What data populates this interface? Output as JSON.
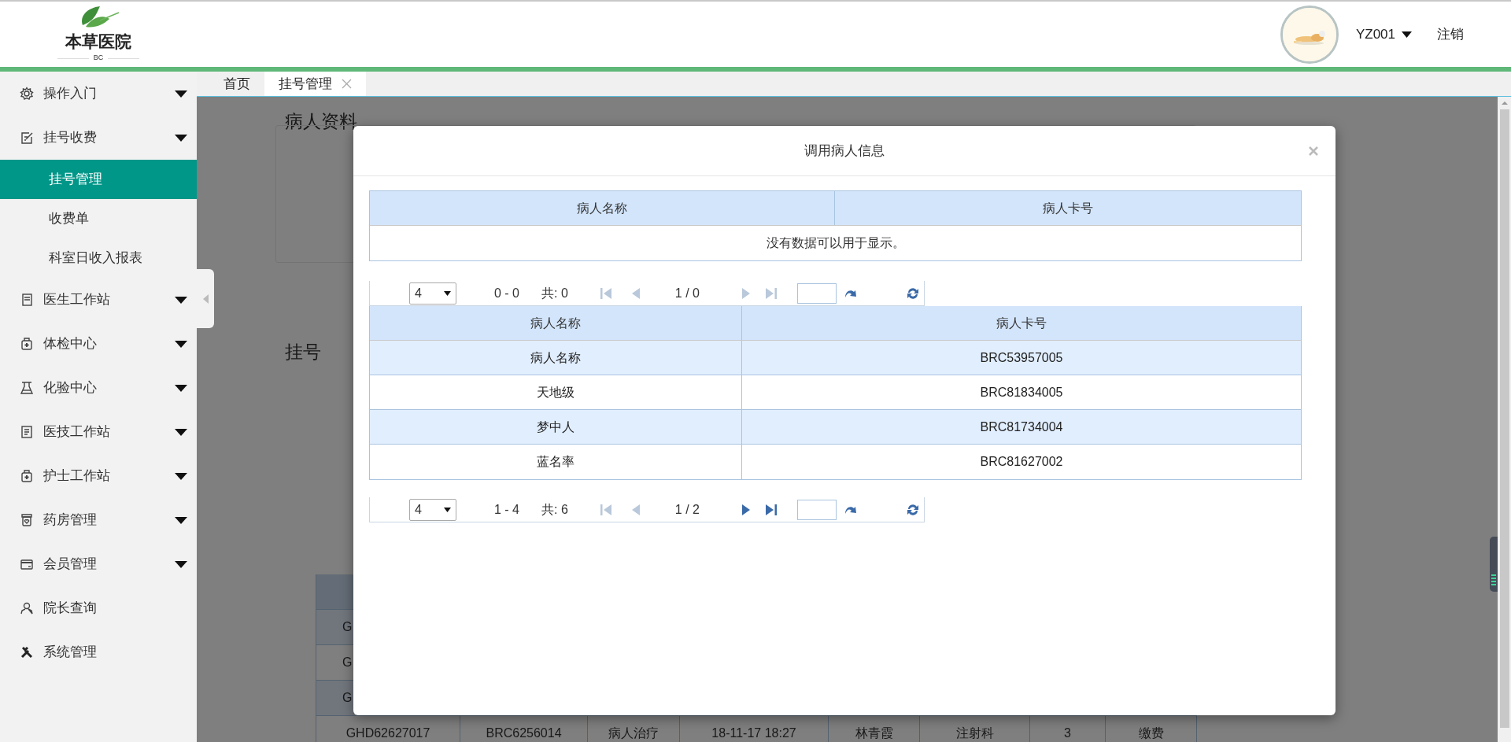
{
  "header": {
    "logo_text": "本草医院",
    "logo_sub": "BC",
    "user": "YZ001",
    "logout": "注销"
  },
  "sidebar": {
    "items": [
      {
        "label": "操作入门",
        "has_submenu": true,
        "selected": false
      },
      {
        "label": "挂号收费",
        "has_submenu": true,
        "selected": false,
        "children": [
          {
            "label": "挂号管理",
            "selected": true
          },
          {
            "label": "收费单",
            "selected": false
          },
          {
            "label": "科室日收入报表",
            "selected": false
          }
        ]
      },
      {
        "label": "医生工作站",
        "has_submenu": true,
        "selected": false
      },
      {
        "label": "体检中心",
        "has_submenu": true,
        "selected": false
      },
      {
        "label": "化验中心",
        "has_submenu": true,
        "selected": false
      },
      {
        "label": "医技工作站",
        "has_submenu": true,
        "selected": false
      },
      {
        "label": "护士工作站",
        "has_submenu": true,
        "selected": false
      },
      {
        "label": "药房管理",
        "has_submenu": true,
        "selected": false
      },
      {
        "label": "会员管理",
        "has_submenu": true,
        "selected": false
      },
      {
        "label": "院长查询",
        "has_submenu": false,
        "selected": false
      },
      {
        "label": "系统管理",
        "has_submenu": false,
        "selected": false
      }
    ]
  },
  "tabs": [
    {
      "label": "首页",
      "selected": false,
      "closable": false
    },
    {
      "label": "挂号管理",
      "selected": true,
      "closable": true
    }
  ],
  "background": {
    "sections": [
      "病人资料",
      "挂号"
    ],
    "table": {
      "rows": [
        {
          "cells": [
            "G"
          ]
        },
        {
          "cells": [
            "G"
          ]
        },
        {
          "cells": [
            "G"
          ]
        },
        {
          "cells": [
            "GHD62627017",
            "BRC6256014",
            "病人治疗",
            "18-11-17 18:27",
            "林青霞",
            "注射科",
            "3",
            "缴费"
          ]
        }
      ]
    }
  },
  "modal": {
    "title": "调用病人信息",
    "search_table": {
      "columns": [
        "病人名称",
        "病人卡号"
      ],
      "empty_message": "没有数据可以用于显示。"
    },
    "pager_top": {
      "page_size": "4",
      "range": "0 - 0",
      "total": "共: 0",
      "page": "1 / 0",
      "first_enabled": false,
      "prev_enabled": false,
      "next_enabled": false,
      "last_enabled": false
    },
    "results_table": {
      "columns": [
        "病人名称",
        "病人卡号"
      ],
      "rows": [
        {
          "cells": [
            "病人名称",
            "BRC53957005"
          ]
        },
        {
          "cells": [
            "天地级",
            "BRC81834005"
          ]
        },
        {
          "cells": [
            "梦中人",
            "BRC81734004"
          ]
        },
        {
          "cells": [
            "蓝名率",
            "BRC81627002"
          ]
        }
      ]
    },
    "pager_bottom": {
      "page_size": "4",
      "range": "1 - 4",
      "total": "共: 6",
      "page": "1 / 2",
      "first_enabled": false,
      "prev_enabled": false,
      "next_enabled": true,
      "last_enabled": true
    }
  }
}
